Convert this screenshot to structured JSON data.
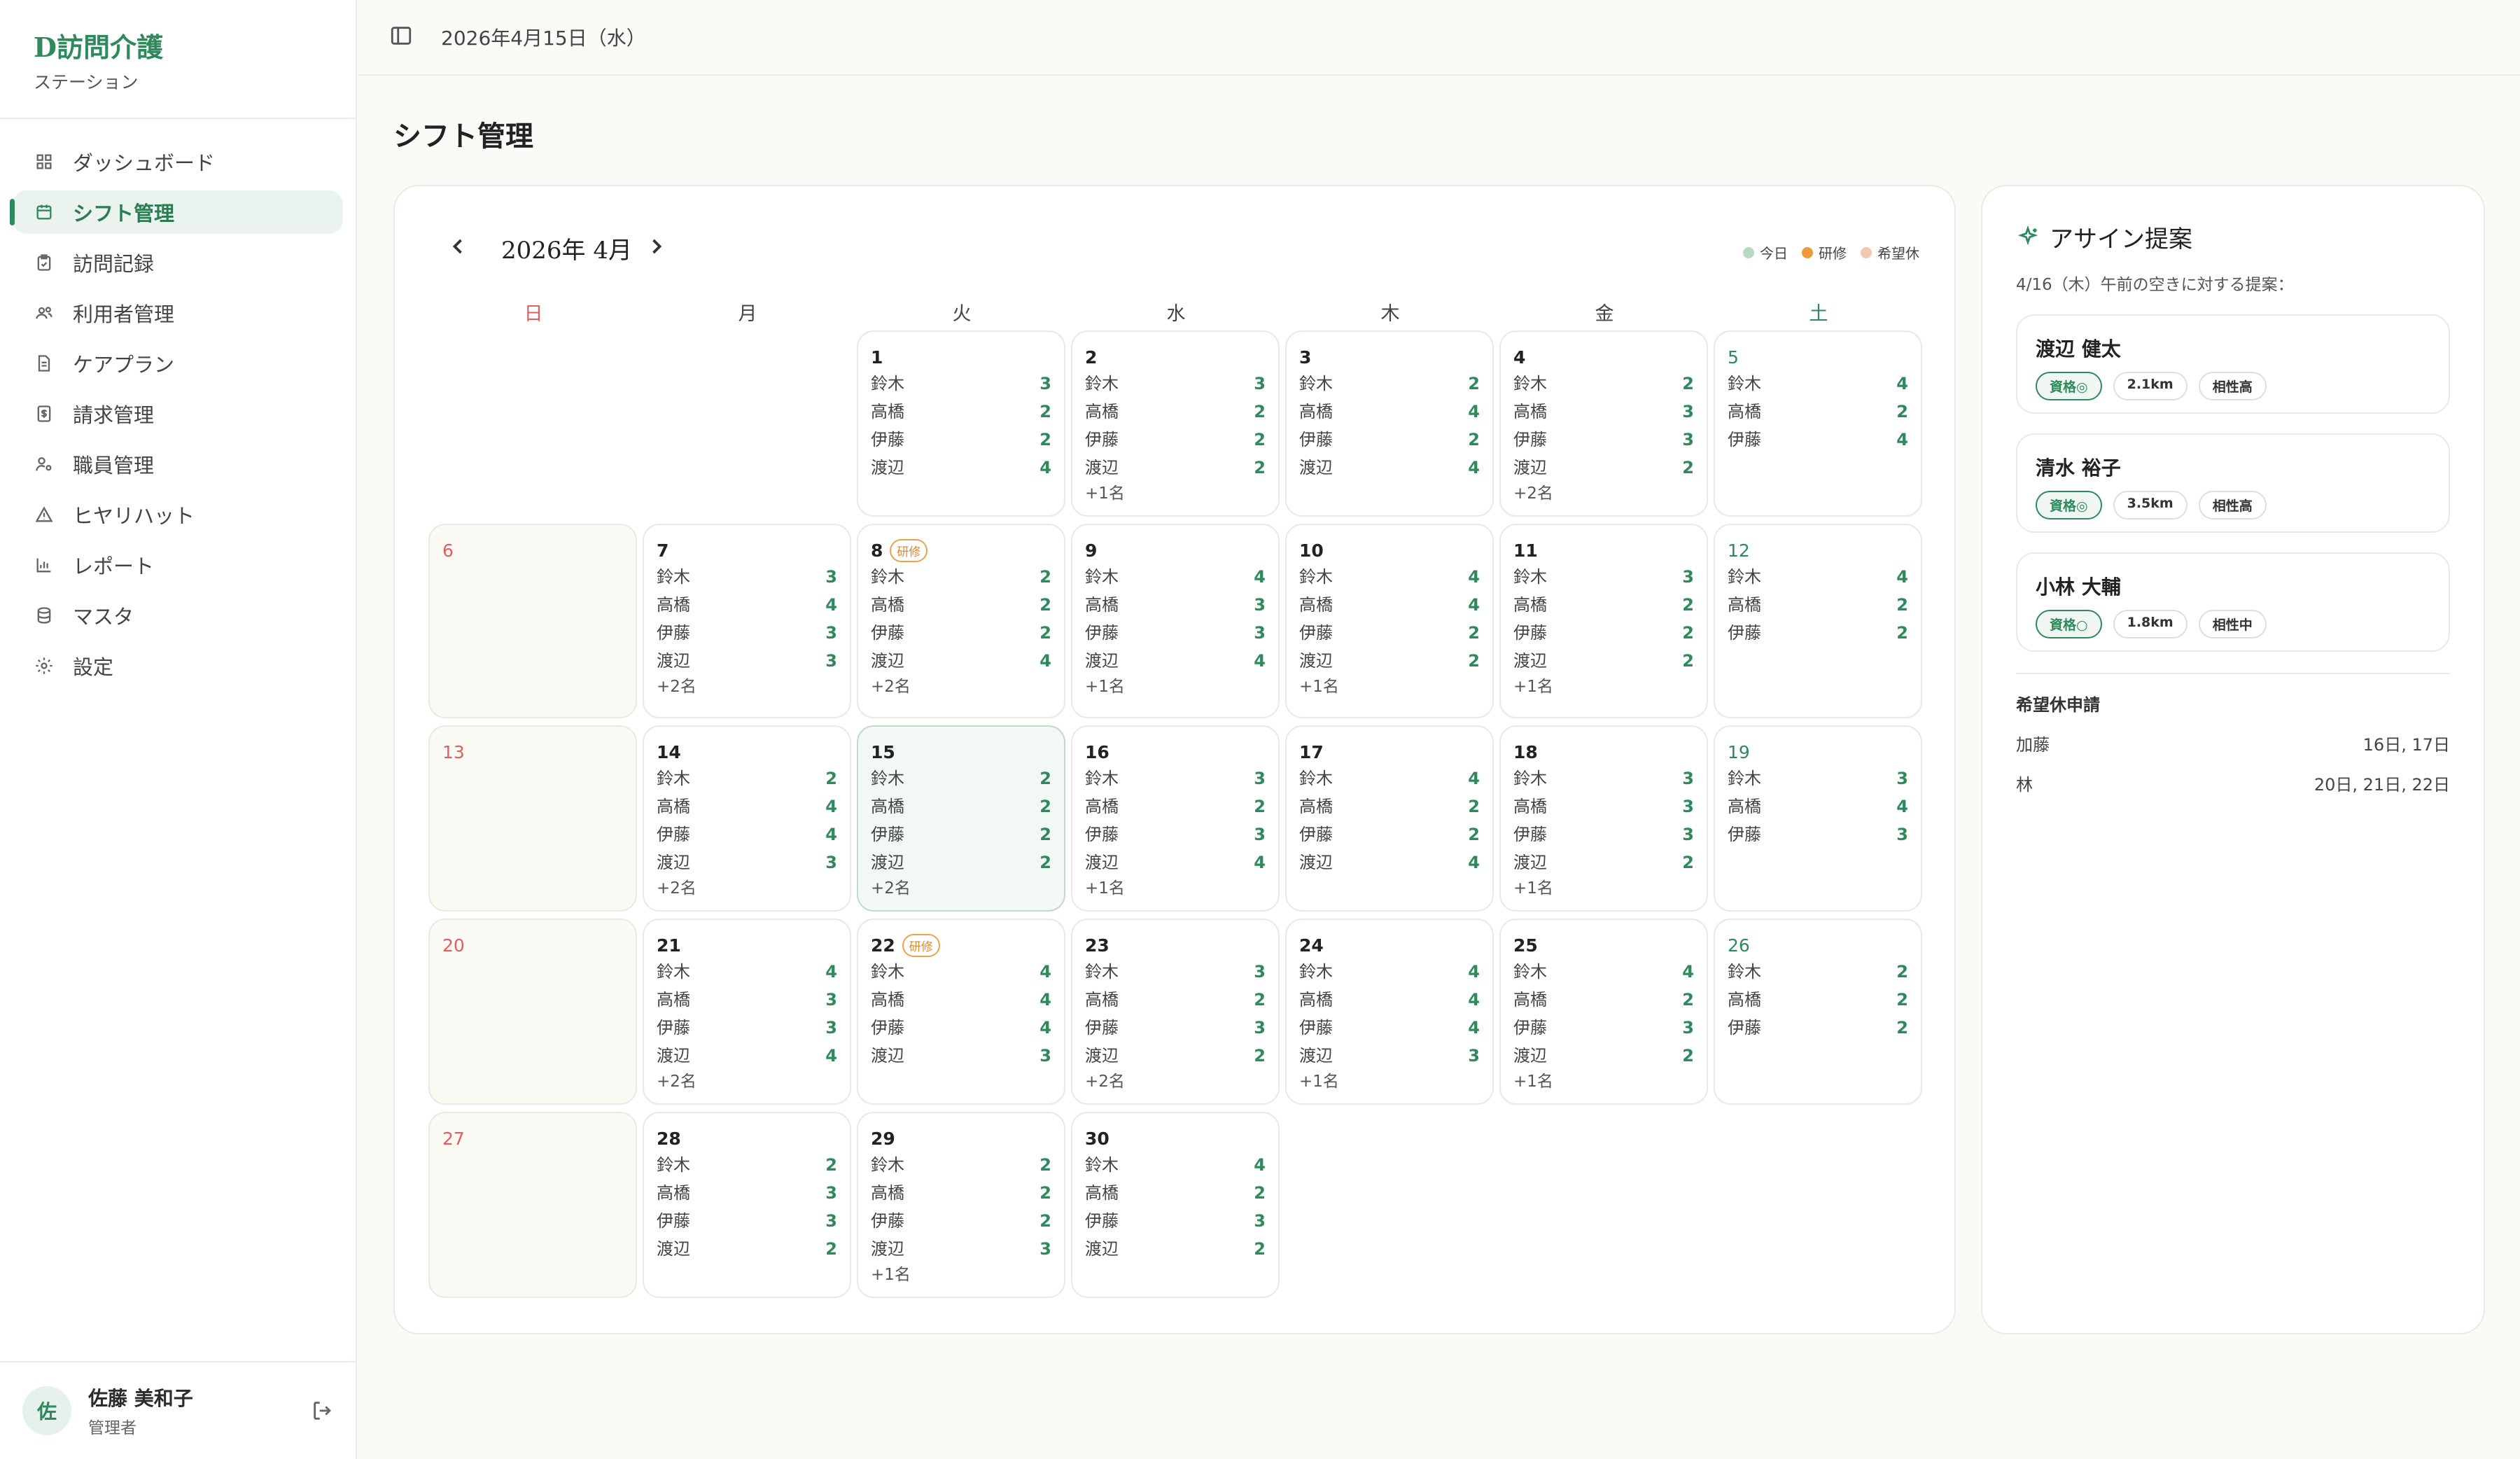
{
  "brand": {
    "title": "D訪問介護",
    "subtitle": "ステーション"
  },
  "nav": [
    {
      "label": "ダッシュボード",
      "icon": "dashboard-icon"
    },
    {
      "label": "シフト管理",
      "icon": "calendar-icon",
      "active": true
    },
    {
      "label": "訪問記録",
      "icon": "clipboard-icon"
    },
    {
      "label": "利用者管理",
      "icon": "users-icon"
    },
    {
      "label": "ケアプラン",
      "icon": "document-icon"
    },
    {
      "label": "請求管理",
      "icon": "billing-icon"
    },
    {
      "label": "職員管理",
      "icon": "staff-icon"
    },
    {
      "label": "ヒヤリハット",
      "icon": "warning-icon"
    },
    {
      "label": "レポート",
      "icon": "chart-icon"
    },
    {
      "label": "マスタ",
      "icon": "database-icon"
    },
    {
      "label": "設定",
      "icon": "gear-icon"
    }
  ],
  "user": {
    "initial": "佐",
    "name": "佐藤 美和子",
    "role": "管理者"
  },
  "topbar": {
    "date": "2026年4月15日（水）"
  },
  "page": {
    "title": "シフト管理"
  },
  "calendar": {
    "month_label": "2026年 4月",
    "legend": [
      {
        "label": "今日",
        "color": "#b7d8c4"
      },
      {
        "label": "研修",
        "color": "#ef9a3a"
      },
      {
        "label": "希望休",
        "color": "#f4c7b0"
      }
    ],
    "weekdays": [
      "日",
      "月",
      "火",
      "水",
      "木",
      "金",
      "土"
    ],
    "days": [
      {
        "d": "1",
        "staff": [
          [
            "鈴木",
            "3"
          ],
          [
            "高橋",
            "2"
          ],
          [
            "伊藤",
            "2"
          ],
          [
            "渡辺",
            "4"
          ]
        ],
        "more": ""
      },
      {
        "d": "2",
        "staff": [
          [
            "鈴木",
            "3"
          ],
          [
            "高橋",
            "2"
          ],
          [
            "伊藤",
            "2"
          ],
          [
            "渡辺",
            "2"
          ]
        ],
        "more": "+1名"
      },
      {
        "d": "3",
        "staff": [
          [
            "鈴木",
            "2"
          ],
          [
            "高橋",
            "4"
          ],
          [
            "伊藤",
            "2"
          ],
          [
            "渡辺",
            "4"
          ]
        ],
        "more": ""
      },
      {
        "d": "4",
        "staff": [
          [
            "鈴木",
            "2"
          ],
          [
            "高橋",
            "3"
          ],
          [
            "伊藤",
            "3"
          ],
          [
            "渡辺",
            "2"
          ]
        ],
        "more": "+2名"
      },
      {
        "d": "5",
        "staff": [
          [
            "鈴木",
            "4"
          ],
          [
            "高橋",
            "2"
          ],
          [
            "伊藤",
            "4"
          ]
        ],
        "more": ""
      },
      {
        "d": "6",
        "staff": [],
        "more": ""
      },
      {
        "d": "7",
        "staff": [
          [
            "鈴木",
            "3"
          ],
          [
            "高橋",
            "4"
          ],
          [
            "伊藤",
            "3"
          ],
          [
            "渡辺",
            "3"
          ]
        ],
        "more": "+2名"
      },
      {
        "d": "8",
        "badge": "研修",
        "staff": [
          [
            "鈴木",
            "2"
          ],
          [
            "高橋",
            "2"
          ],
          [
            "伊藤",
            "2"
          ],
          [
            "渡辺",
            "4"
          ]
        ],
        "more": "+2名"
      },
      {
        "d": "9",
        "staff": [
          [
            "鈴木",
            "4"
          ],
          [
            "高橋",
            "3"
          ],
          [
            "伊藤",
            "3"
          ],
          [
            "渡辺",
            "4"
          ]
        ],
        "more": "+1名"
      },
      {
        "d": "10",
        "staff": [
          [
            "鈴木",
            "4"
          ],
          [
            "高橋",
            "4"
          ],
          [
            "伊藤",
            "2"
          ],
          [
            "渡辺",
            "2"
          ]
        ],
        "more": "+1名"
      },
      {
        "d": "11",
        "staff": [
          [
            "鈴木",
            "3"
          ],
          [
            "高橋",
            "2"
          ],
          [
            "伊藤",
            "2"
          ],
          [
            "渡辺",
            "2"
          ]
        ],
        "more": "+1名"
      },
      {
        "d": "12",
        "staff": [
          [
            "鈴木",
            "4"
          ],
          [
            "高橋",
            "2"
          ],
          [
            "伊藤",
            "2"
          ]
        ],
        "more": ""
      },
      {
        "d": "13",
        "staff": [],
        "more": ""
      },
      {
        "d": "14",
        "staff": [
          [
            "鈴木",
            "2"
          ],
          [
            "高橋",
            "4"
          ],
          [
            "伊藤",
            "4"
          ],
          [
            "渡辺",
            "3"
          ]
        ],
        "more": "+2名"
      },
      {
        "d": "15",
        "today": true,
        "staff": [
          [
            "鈴木",
            "2"
          ],
          [
            "高橋",
            "2"
          ],
          [
            "伊藤",
            "2"
          ],
          [
            "渡辺",
            "2"
          ]
        ],
        "more": "+2名"
      },
      {
        "d": "16",
        "staff": [
          [
            "鈴木",
            "3"
          ],
          [
            "高橋",
            "2"
          ],
          [
            "伊藤",
            "3"
          ],
          [
            "渡辺",
            "4"
          ]
        ],
        "more": "+1名"
      },
      {
        "d": "17",
        "staff": [
          [
            "鈴木",
            "4"
          ],
          [
            "高橋",
            "2"
          ],
          [
            "伊藤",
            "2"
          ],
          [
            "渡辺",
            "4"
          ]
        ],
        "more": ""
      },
      {
        "d": "18",
        "staff": [
          [
            "鈴木",
            "3"
          ],
          [
            "高橋",
            "3"
          ],
          [
            "伊藤",
            "3"
          ],
          [
            "渡辺",
            "2"
          ]
        ],
        "more": "+1名"
      },
      {
        "d": "19",
        "staff": [
          [
            "鈴木",
            "3"
          ],
          [
            "高橋",
            "4"
          ],
          [
            "伊藤",
            "3"
          ]
        ],
        "more": ""
      },
      {
        "d": "20",
        "staff": [],
        "more": ""
      },
      {
        "d": "21",
        "staff": [
          [
            "鈴木",
            "4"
          ],
          [
            "高橋",
            "3"
          ],
          [
            "伊藤",
            "3"
          ],
          [
            "渡辺",
            "4"
          ]
        ],
        "more": "+2名"
      },
      {
        "d": "22",
        "badge": "研修",
        "staff": [
          [
            "鈴木",
            "4"
          ],
          [
            "高橋",
            "4"
          ],
          [
            "伊藤",
            "4"
          ],
          [
            "渡辺",
            "3"
          ]
        ],
        "more": ""
      },
      {
        "d": "23",
        "staff": [
          [
            "鈴木",
            "3"
          ],
          [
            "高橋",
            "2"
          ],
          [
            "伊藤",
            "3"
          ],
          [
            "渡辺",
            "2"
          ]
        ],
        "more": "+2名"
      },
      {
        "d": "24",
        "staff": [
          [
            "鈴木",
            "4"
          ],
          [
            "高橋",
            "4"
          ],
          [
            "伊藤",
            "4"
          ],
          [
            "渡辺",
            "3"
          ]
        ],
        "more": "+1名"
      },
      {
        "d": "25",
        "staff": [
          [
            "鈴木",
            "4"
          ],
          [
            "高橋",
            "2"
          ],
          [
            "伊藤",
            "3"
          ],
          [
            "渡辺",
            "2"
          ]
        ],
        "more": "+1名"
      },
      {
        "d": "26",
        "staff": [
          [
            "鈴木",
            "2"
          ],
          [
            "高橋",
            "2"
          ],
          [
            "伊藤",
            "2"
          ]
        ],
        "more": ""
      },
      {
        "d": "27",
        "staff": [],
        "more": ""
      },
      {
        "d": "28",
        "staff": [
          [
            "鈴木",
            "2"
          ],
          [
            "高橋",
            "3"
          ],
          [
            "伊藤",
            "3"
          ],
          [
            "渡辺",
            "2"
          ]
        ],
        "more": ""
      },
      {
        "d": "29",
        "staff": [
          [
            "鈴木",
            "2"
          ],
          [
            "高橋",
            "2"
          ],
          [
            "伊藤",
            "2"
          ],
          [
            "渡辺",
            "3"
          ]
        ],
        "more": "+1名"
      },
      {
        "d": "30",
        "staff": [
          [
            "鈴木",
            "4"
          ],
          [
            "高橋",
            "2"
          ],
          [
            "伊藤",
            "3"
          ],
          [
            "渡辺",
            "2"
          ]
        ],
        "more": ""
      }
    ]
  },
  "assign": {
    "title": "アサイン提案",
    "subtitle": "4/16（木）午前の空きに対する提案：",
    "candidates": [
      {
        "name": "渡辺 健太",
        "qual": "資格◎",
        "distance": "2.1km",
        "affinity": "相性高"
      },
      {
        "name": "清水 裕子",
        "qual": "資格◎",
        "distance": "3.5km",
        "affinity": "相性高"
      },
      {
        "name": "小林 大輔",
        "qual": "資格○",
        "distance": "1.8km",
        "affinity": "相性中"
      }
    ],
    "requests_title": "希望休申請",
    "requests": [
      {
        "name": "加藤",
        "dates": "16日, 17日"
      },
      {
        "name": "林",
        "dates": "20日, 21日, 22日"
      }
    ]
  }
}
